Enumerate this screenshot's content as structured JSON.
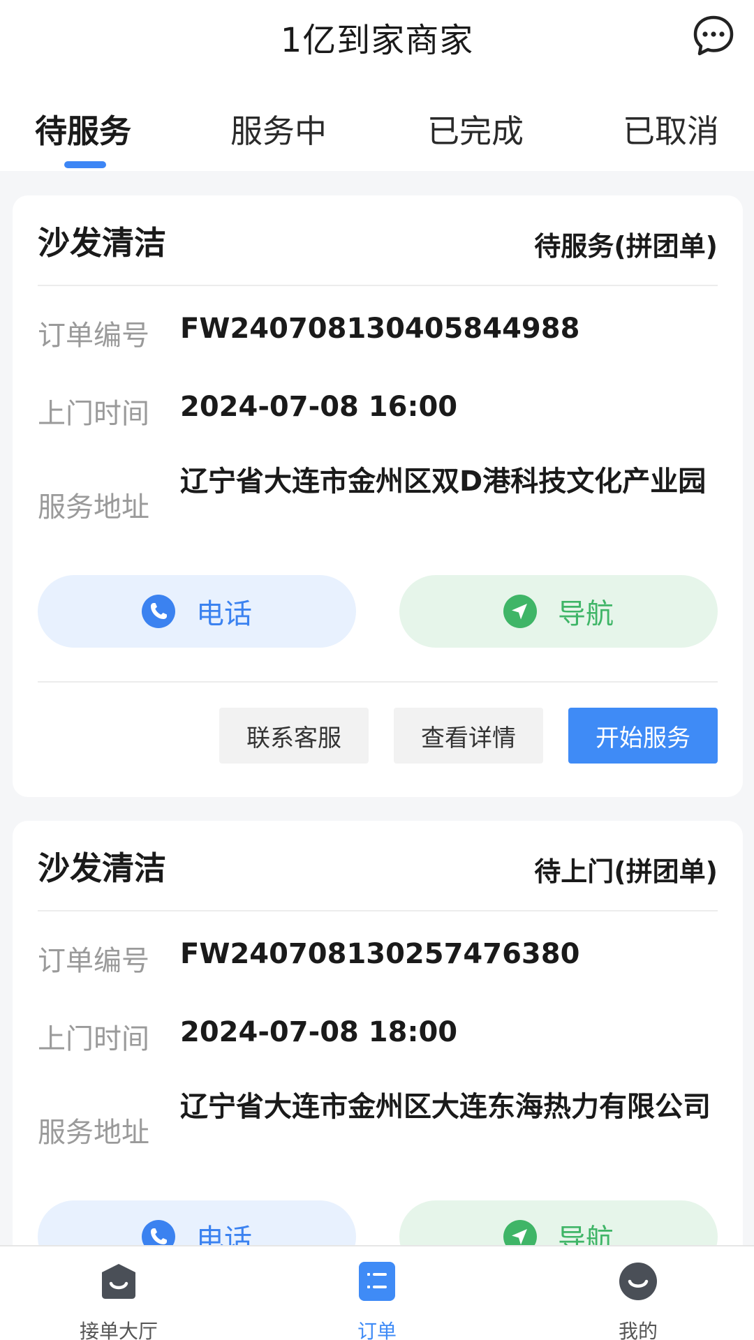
{
  "header": {
    "title": "1亿到家商家",
    "chat_icon": "chat-bubble-icon"
  },
  "tabs": [
    {
      "label": "待服务",
      "active": true
    },
    {
      "label": "服务中",
      "active": false
    },
    {
      "label": "已完成",
      "active": false
    },
    {
      "label": "已取消",
      "active": false
    }
  ],
  "orders": [
    {
      "title": "沙发清洁",
      "status": "待服务(拼团单)",
      "order_no_label": "订单编号",
      "order_no": "FW2407081304058449​88",
      "visit_time_label": "上门时间",
      "visit_time": "2024-07-08 16:00",
      "address_label": "服务地址",
      "address": "辽宁省大连市金州区双D港科技文化产业园",
      "call_label": "电话",
      "nav_label": "导航",
      "contact_label": "联系客服",
      "detail_label": "查看详情",
      "start_label": "开始服务"
    },
    {
      "title": "沙发清洁",
      "status": "待上门(拼团单)",
      "order_no_label": "订单编号",
      "order_no": "FW240708130257476380",
      "visit_time_label": "上门时间",
      "visit_time": "2024-07-08 18:00",
      "address_label": "服务地址",
      "address": "辽宁省大连市金州区大连东海热力有限公司",
      "call_label": "电话",
      "nav_label": "导航"
    }
  ],
  "bottom_nav": [
    {
      "label": "接单大厅",
      "icon": "hall-icon",
      "active": false
    },
    {
      "label": "订单",
      "icon": "order-list-icon",
      "active": true
    },
    {
      "label": "我的",
      "icon": "profile-icon",
      "active": false
    }
  ],
  "colors": {
    "accent": "#3f8bf6",
    "nav_green": "#3fb567",
    "call_bg": "#e8f1fe",
    "nav_bg": "#e6f5ea",
    "page_bg": "#f5f6f8"
  }
}
